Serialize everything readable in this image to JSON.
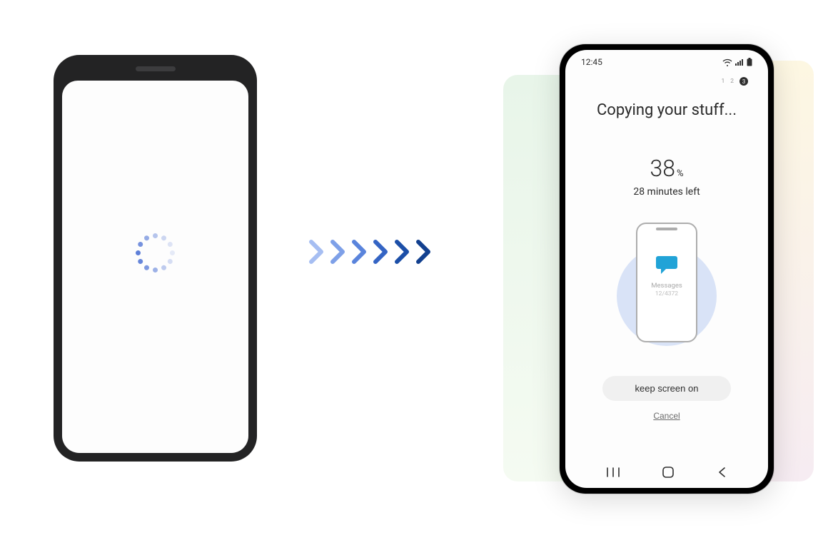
{
  "left_phone": {
    "state": "loading"
  },
  "right_phone": {
    "status_time": "12:45",
    "steps": {
      "s1": "1",
      "s2": "2",
      "s3": "3"
    },
    "title": "Copying your stuff...",
    "percent_value": "38",
    "percent_unit": "%",
    "time_left": "28 minutes left",
    "illustration": {
      "item_label": "Messages",
      "item_count": "12/4372"
    },
    "keep_screen_label": "keep screen on",
    "cancel_label": "Cancel"
  },
  "colors": {
    "chevron": "#1d4b9a",
    "spinner": "#4f74cf",
    "msg_icon": "#21a3d7"
  }
}
